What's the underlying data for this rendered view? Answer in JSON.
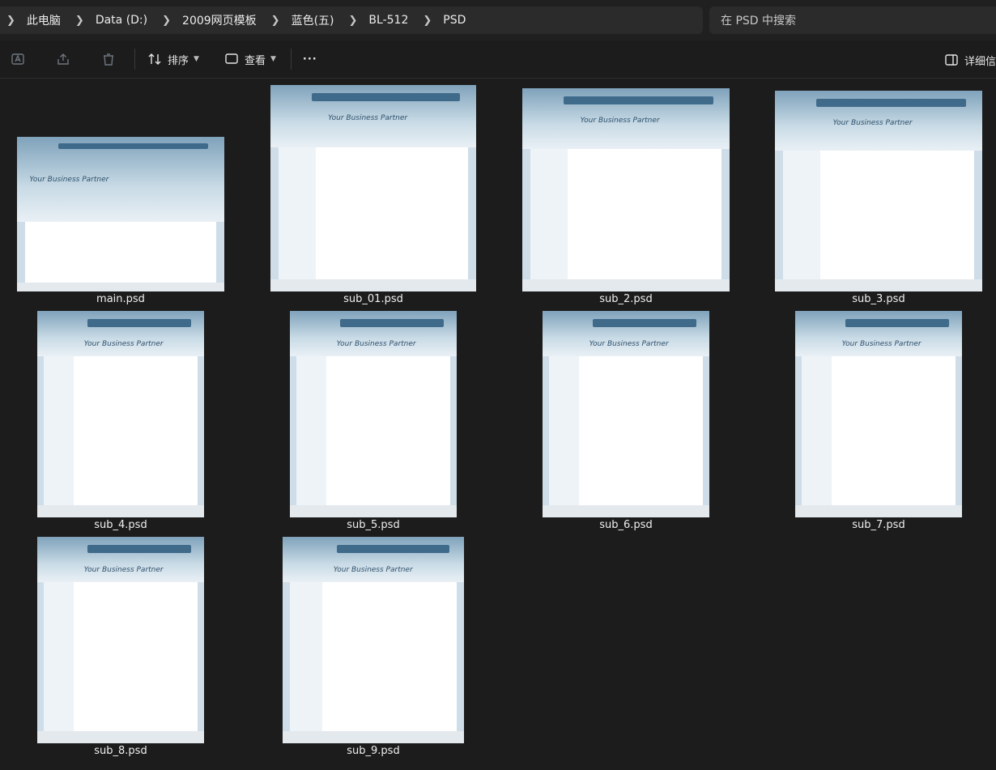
{
  "breadcrumb": [
    "此电脑",
    "Data (D:)",
    "2009网页模板",
    "蓝色(五)",
    "BL-512",
    "PSD"
  ],
  "search": {
    "placeholder": "在 PSD 中搜索"
  },
  "toolbar": {
    "sort_label": "排序",
    "view_label": "查看",
    "more_label": "···",
    "details_label": "详细信"
  },
  "thumb_caption": "Your Business Partner",
  "files": [
    {
      "name": "main.psd"
    },
    {
      "name": "sub_01.psd"
    },
    {
      "name": "sub_2.psd"
    },
    {
      "name": "sub_3.psd"
    },
    {
      "name": "sub_4.psd"
    },
    {
      "name": "sub_5.psd"
    },
    {
      "name": "sub_6.psd"
    },
    {
      "name": "sub_7.psd"
    },
    {
      "name": "sub_8.psd"
    },
    {
      "name": "sub_9.psd"
    }
  ]
}
